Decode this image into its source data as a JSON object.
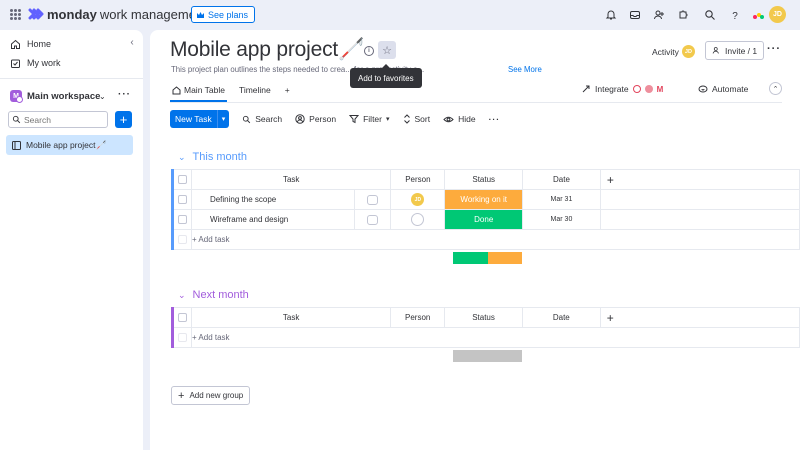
{
  "app": {
    "brand_bold": "monday",
    "brand_rest": "work management",
    "see_plans": "See plans",
    "user_initials": "JD"
  },
  "colors": {
    "accent": "#0073ea",
    "selected_bg": "#cce5ff",
    "working_on_it": "#fdab3d",
    "done": "#00c875",
    "this_month": "#579bfc",
    "next_month": "#a25ddc"
  },
  "top_icons": [
    "bell-icon",
    "inbox-icon",
    "invite-members-icon",
    "apps-icon",
    "search-icon",
    "help-icon"
  ],
  "sidebar": {
    "items": [
      {
        "label": "Home",
        "icon": "home-icon"
      },
      {
        "label": "My work",
        "icon": "my-work-icon"
      }
    ],
    "workspace": {
      "badge": "M",
      "name": "Main workspace"
    },
    "search_placeholder": "Search",
    "boards": [
      {
        "label": "Mobile app project🦯"
      }
    ]
  },
  "board": {
    "title": "Mobile app project🦯",
    "description": "This project plan outlines the steps needed to crea... for a productivity a...",
    "see_more": "See More",
    "tooltip": "Add to favorites",
    "activity": "Activity",
    "invite": "Invite / 1",
    "tabs": [
      {
        "label": "Main Table"
      },
      {
        "label": "Timeline"
      }
    ],
    "integrate": "Integrate",
    "automate": "Automate"
  },
  "toolbar": {
    "new_task": "New Task",
    "search": "Search",
    "person": "Person",
    "filter": "Filter",
    "sort": "Sort",
    "hide": "Hide"
  },
  "columns": {
    "task": "Task",
    "person": "Person",
    "status": "Status",
    "date": "Date"
  },
  "groups": [
    {
      "name": "This month",
      "rows": [
        {
          "task": "Defining the scope",
          "person": "JD",
          "status": "Working on it",
          "date": "Mar 31"
        },
        {
          "task": "Wireframe and design",
          "person": "",
          "status": "Done",
          "date": "Mar 30"
        }
      ],
      "add_task": "+ Add task",
      "status_summary": [
        {
          "status": "Done",
          "fraction": 0.5
        },
        {
          "status": "Working on it",
          "fraction": 0.5
        }
      ]
    },
    {
      "name": "Next month",
      "rows": [],
      "add_task": "+ Add task",
      "status_summary": [
        {
          "status": "empty",
          "fraction": 1.0
        }
      ]
    }
  ],
  "add_new_group": "Add new group"
}
